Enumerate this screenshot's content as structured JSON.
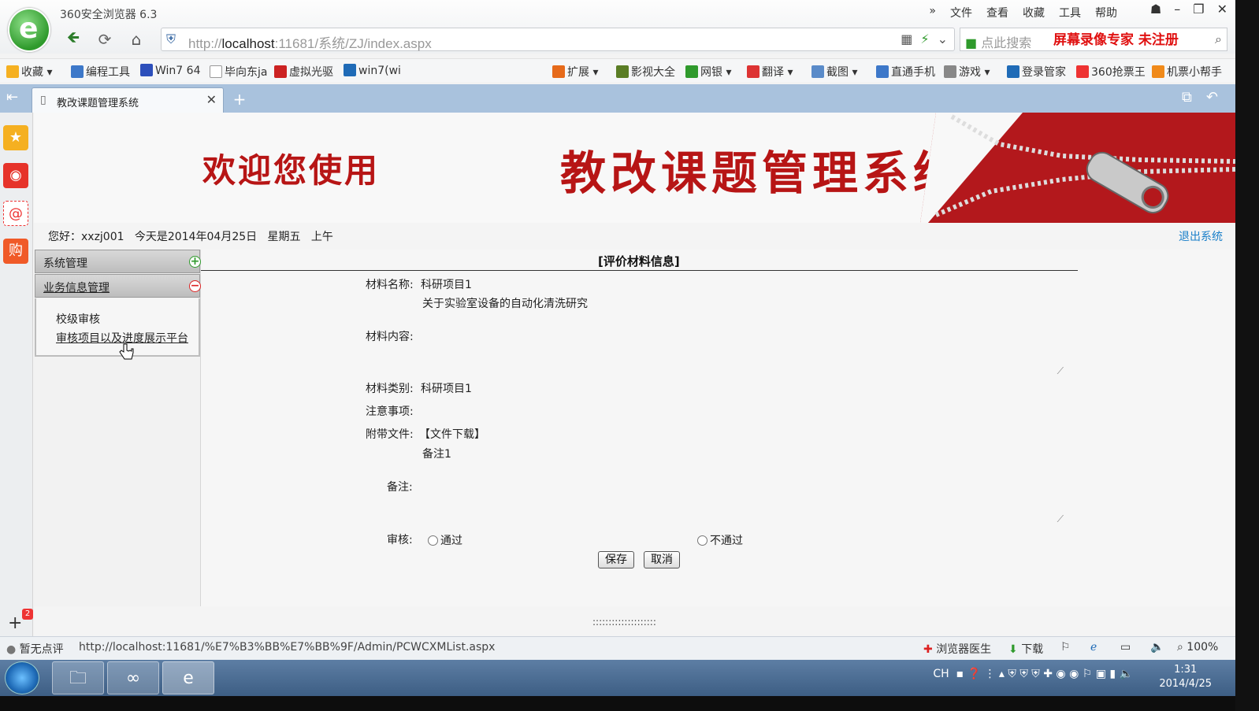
{
  "browser": {
    "app_title": "360安全浏览器 6.3",
    "menus": [
      "文件",
      "查看",
      "收藏",
      "工具",
      "帮助"
    ],
    "address": {
      "scheme_host": "http://",
      "host": "localhost",
      "rest": ":11681/系统/ZJ/index.aspx"
    },
    "search_placeholder": "点此搜索",
    "recorder_watermark": "屏幕录像专家  未注册",
    "bookmarks": [
      "收藏",
      "编程工具",
      "Win7 64",
      "毕向东ja",
      "虚拟光驱",
      "win7(wi",
      "扩展",
      "影视大全",
      "网银",
      "翻译",
      "截图",
      "直通手机",
      "游戏",
      "登录管家",
      "360抢票王",
      "机票小帮手"
    ],
    "tab_title": "教改课题管理系统",
    "status_left": "暂无点评",
    "status_url": "http://localhost:11681/%E7%B3%BB%E7%BB%9F/Admin/PCWCXMList.aspx",
    "status_doctor": "浏览器医生",
    "status_download": "下载",
    "zoom": "100%",
    "rail_badge": "2"
  },
  "banner": {
    "welcome": "欢迎您使用",
    "system_name": "教改课题管理系统"
  },
  "header": {
    "greeting": "您好：xxzj001   今天是2014年04月25日   星期五   上午",
    "logout": "退出系统"
  },
  "sidebar": {
    "sections": [
      {
        "label": "系统管理",
        "state": "collapsed"
      },
      {
        "label": "业务信息管理",
        "state": "expanded"
      }
    ],
    "items": [
      "校级审核",
      "审核项目以及进度展示平台"
    ]
  },
  "form": {
    "title": "[评价材料信息]",
    "material_name_label": "材料名称:",
    "material_name": "科研项目1",
    "material_desc": "关于实验室设备的自动化清洗研究",
    "material_content_label": "材料内容:",
    "material_type_label": "材料类别:",
    "material_type": "科研项目1",
    "notes_label": "注意事项:",
    "attachment_label": "附带文件:",
    "attachment_link": "【文件下载】",
    "attachment_note": "备注1",
    "remark_label": "备注:",
    "review_label": "审核:",
    "review_options": [
      "通过",
      "不通过"
    ],
    "save": "保存",
    "cancel": "取消"
  },
  "splitter": "::::::::::::::::::::",
  "taskbar": {
    "time": "1:31",
    "date": "2014/4/25",
    "lang": "CH"
  }
}
